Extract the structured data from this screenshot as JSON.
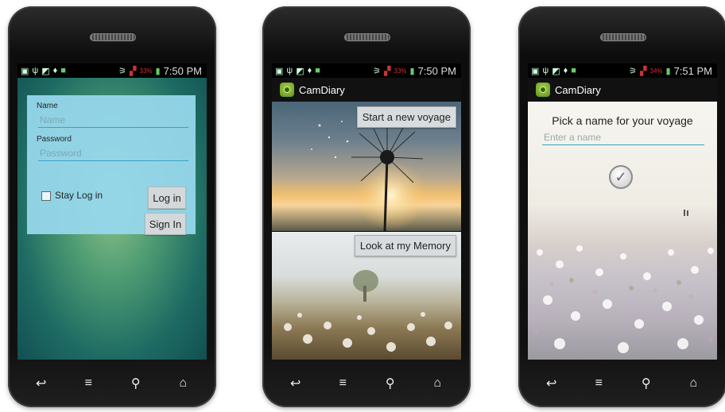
{
  "statusbars": [
    {
      "battery": "33%",
      "time": "7:50 PM"
    },
    {
      "battery": "33%",
      "time": "7:50 PM"
    },
    {
      "battery": "34%",
      "time": "7:51 PM"
    }
  ],
  "login": {
    "name_label": "Name",
    "name_placeholder": "Name",
    "password_label": "Password",
    "password_placeholder": "Password",
    "stay_label": "Stay Log in",
    "login_button": "Log in",
    "signin_button": "Sign In"
  },
  "home": {
    "app_title": "CamDiary",
    "start_button": "Start a new voyage",
    "memory_button": "Look at my Memory"
  },
  "voyage": {
    "app_title": "CamDiary",
    "prompt": "Pick a name for your voyage",
    "name_placeholder": "Enter a name"
  },
  "navbar_icons": [
    "back-icon",
    "menu-icon",
    "search-icon",
    "home-icon"
  ]
}
